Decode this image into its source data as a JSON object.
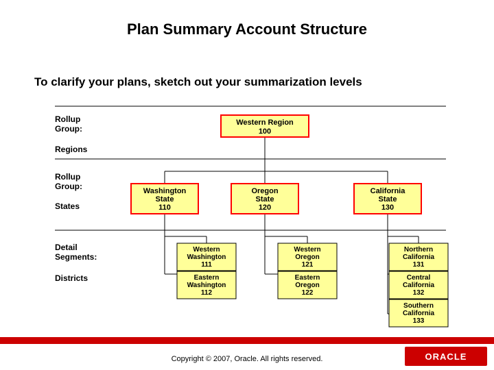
{
  "title": "Plan Summary Account Structure",
  "subtitle": "To clarify your plans, sketch out your summarization levels",
  "labels": {
    "l1a": "Rollup",
    "l1b": "Group:",
    "l1c": "Regions",
    "l2a": "Rollup",
    "l2b": "Group:",
    "l2c": "States",
    "l3a": "Detail",
    "l3b": "Segments:",
    "l3c": "Districts"
  },
  "nodes": {
    "region": {
      "l1": "Western Region",
      "l2": "100"
    },
    "wa": {
      "l1": "Washington",
      "l2": "State",
      "l3": "110"
    },
    "or": {
      "l1": "Oregon",
      "l2": "State",
      "l3": "120"
    },
    "ca": {
      "l1": "California",
      "l2": "State",
      "l3": "130"
    },
    "wwa": {
      "l1": "Western",
      "l2": "Washington",
      "l3": "111"
    },
    "ewa": {
      "l1": "Eastern",
      "l2": "Washington",
      "l3": "112"
    },
    "wor": {
      "l1": "Western",
      "l2": "Oregon",
      "l3": "121"
    },
    "eor": {
      "l1": "Eastern",
      "l2": "Oregon",
      "l3": "122"
    },
    "nca": {
      "l1": "Northern",
      "l2": "California",
      "l3": "131"
    },
    "cca": {
      "l1": "Central",
      "l2": "California",
      "l3": "132"
    },
    "sca": {
      "l1": "Southern",
      "l2": "California",
      "l3": "133"
    }
  },
  "copyright": "Copyright © 2007, Oracle. All rights reserved.",
  "logo": "ORACLE"
}
